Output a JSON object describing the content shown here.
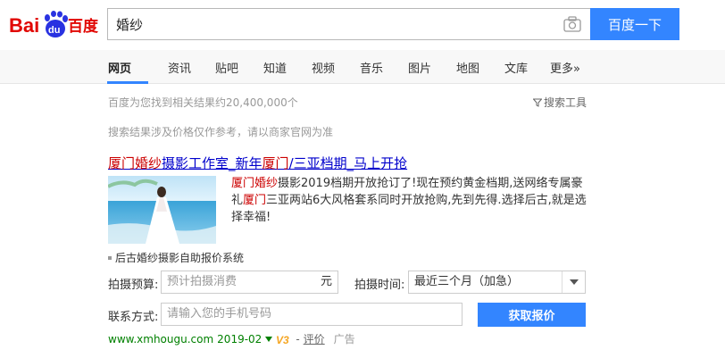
{
  "logo": {
    "text_left": "Bai",
    "text_du": "du",
    "text_right": "百度"
  },
  "search": {
    "query": "婚纱",
    "button_label": "百度一下"
  },
  "tabs": [
    {
      "label": "网页",
      "active": true
    },
    {
      "label": "资讯"
    },
    {
      "label": "贴吧"
    },
    {
      "label": "知道"
    },
    {
      "label": "视频"
    },
    {
      "label": "音乐"
    },
    {
      "label": "图片"
    },
    {
      "label": "地图"
    },
    {
      "label": "文库"
    },
    {
      "label": "更多»"
    }
  ],
  "results": {
    "count_text": "百度为您找到相关结果约20,400,000个",
    "tools_label": "搜索工具",
    "notice": "搜索结果涉及价格仅作参考，请以商家官网为准"
  },
  "ad": {
    "title_parts": [
      "厦门",
      "婚纱",
      "摄影工作室_新年",
      "厦门",
      "/三亚档期_马上开抢"
    ],
    "desc_parts": [
      "厦门婚纱",
      "摄影2019档期开放抢订了!现在预约黄金档期,送网络专属豪礼",
      "厦门",
      "三亚两站6大风格套系同时开放抢购,先到先得.选择后古,就是选择幸福!"
    ],
    "system_line": "后古婚纱摄影自助报价系统",
    "form": {
      "budget_label": "拍摄预算:",
      "budget_placeholder": "预计拍摄消费",
      "budget_unit": "元",
      "time_label": "拍摄时间:",
      "time_value": "最近三个月（加急）",
      "contact_label": "联系方式:",
      "contact_placeholder": "请输入您的手机号码",
      "submit_label": "获取报价"
    },
    "footer": {
      "url": "www.xmhougu.com",
      "date": "2019-02",
      "v_badge": "V3",
      "review_link": "评价",
      "ad_tag": "广告"
    }
  },
  "colors": {
    "brand_red": "#e10602",
    "brand_blue": "#2932e1",
    "button_blue": "#3385ff",
    "link_blue": "#0000cc",
    "highlight_red": "#cc0000",
    "url_green": "#008000"
  }
}
